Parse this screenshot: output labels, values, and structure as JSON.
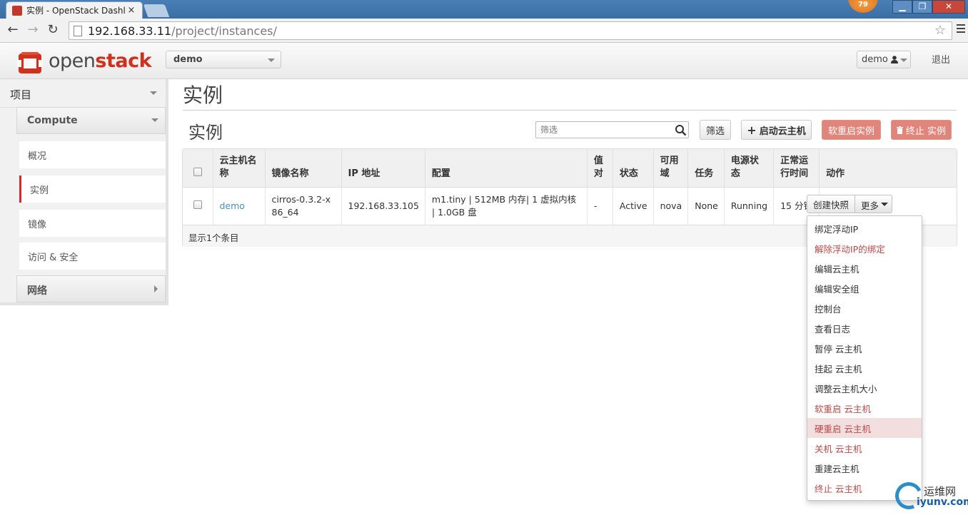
{
  "browser": {
    "tab_title": "实例 - OpenStack Dashl",
    "tab_close": "×",
    "notification_count": "79",
    "url_host": "192.168.33.11",
    "url_path": "/project/instances/",
    "win_min": "▁",
    "win_max": "❐",
    "win_close": "✕"
  },
  "header": {
    "logo_prefix": "open",
    "logo_suffix": "stack",
    "project_select": "demo",
    "user_select": "demo",
    "logout": "退出"
  },
  "sidebar": {
    "project_label": "项目",
    "compute_label": "Compute",
    "items": [
      {
        "label": "概况"
      },
      {
        "label": "实例"
      },
      {
        "label": "镜像"
      },
      {
        "label": "访问 & 安全"
      }
    ],
    "network_label": "网络"
  },
  "main": {
    "page_title": "实例",
    "section_title": "实例",
    "filter_placeholder": "筛选",
    "filter_button": "筛选",
    "launch_button": "启动云主机",
    "soft_reboot_button": "软重启实例",
    "terminate_button": "终止 实例",
    "table": {
      "headers": [
        "",
        "云主机名称",
        "镜像名称",
        "IP 地址",
        "配置",
        "值对",
        "状态",
        "可用域",
        "任务",
        "电源状态",
        "正常运行时间",
        "动作"
      ],
      "rows": [
        {
          "name": "demo",
          "image": "cirros-0.3.2-x86_64",
          "ip": "192.168.33.105",
          "flavor": "m1.tiny | 512MB 内存| 1 虚拟内核 | 1.0GB 盘",
          "keypair": "-",
          "status": "Active",
          "zone": "nova",
          "task": "None",
          "power": "Running",
          "uptime": "15 分钟"
        }
      ],
      "footer": "显示1个条目"
    },
    "snapshot_button": "创建快照",
    "more_button": "更多",
    "actions_menu": [
      {
        "label": "绑定浮动IP",
        "danger": false
      },
      {
        "label": "解除浮动IP的绑定",
        "danger": true
      },
      {
        "label": "编辑云主机",
        "danger": false
      },
      {
        "label": "编辑安全组",
        "danger": false
      },
      {
        "label": "控制台",
        "danger": false
      },
      {
        "label": "查看日志",
        "danger": false
      },
      {
        "label": "暂停 云主机",
        "danger": false
      },
      {
        "label": "挂起 云主机",
        "danger": false
      },
      {
        "label": "调整云主机大小",
        "danger": false
      },
      {
        "label": "软重启 云主机",
        "danger": true
      },
      {
        "label": "硬重启 云主机",
        "danger": true
      },
      {
        "label": "关机 云主机",
        "danger": true
      },
      {
        "label": "重建云主机",
        "danger": false
      },
      {
        "label": "终止 云主机",
        "danger": true
      }
    ]
  },
  "watermark": {
    "line1": "运维网",
    "line2": "iyunv.com"
  },
  "colors": {
    "brand_red": "#d0311d",
    "danger_button": "#e1857a",
    "link_blue": "#4a8ec0",
    "hover_row": "#f2dede"
  }
}
